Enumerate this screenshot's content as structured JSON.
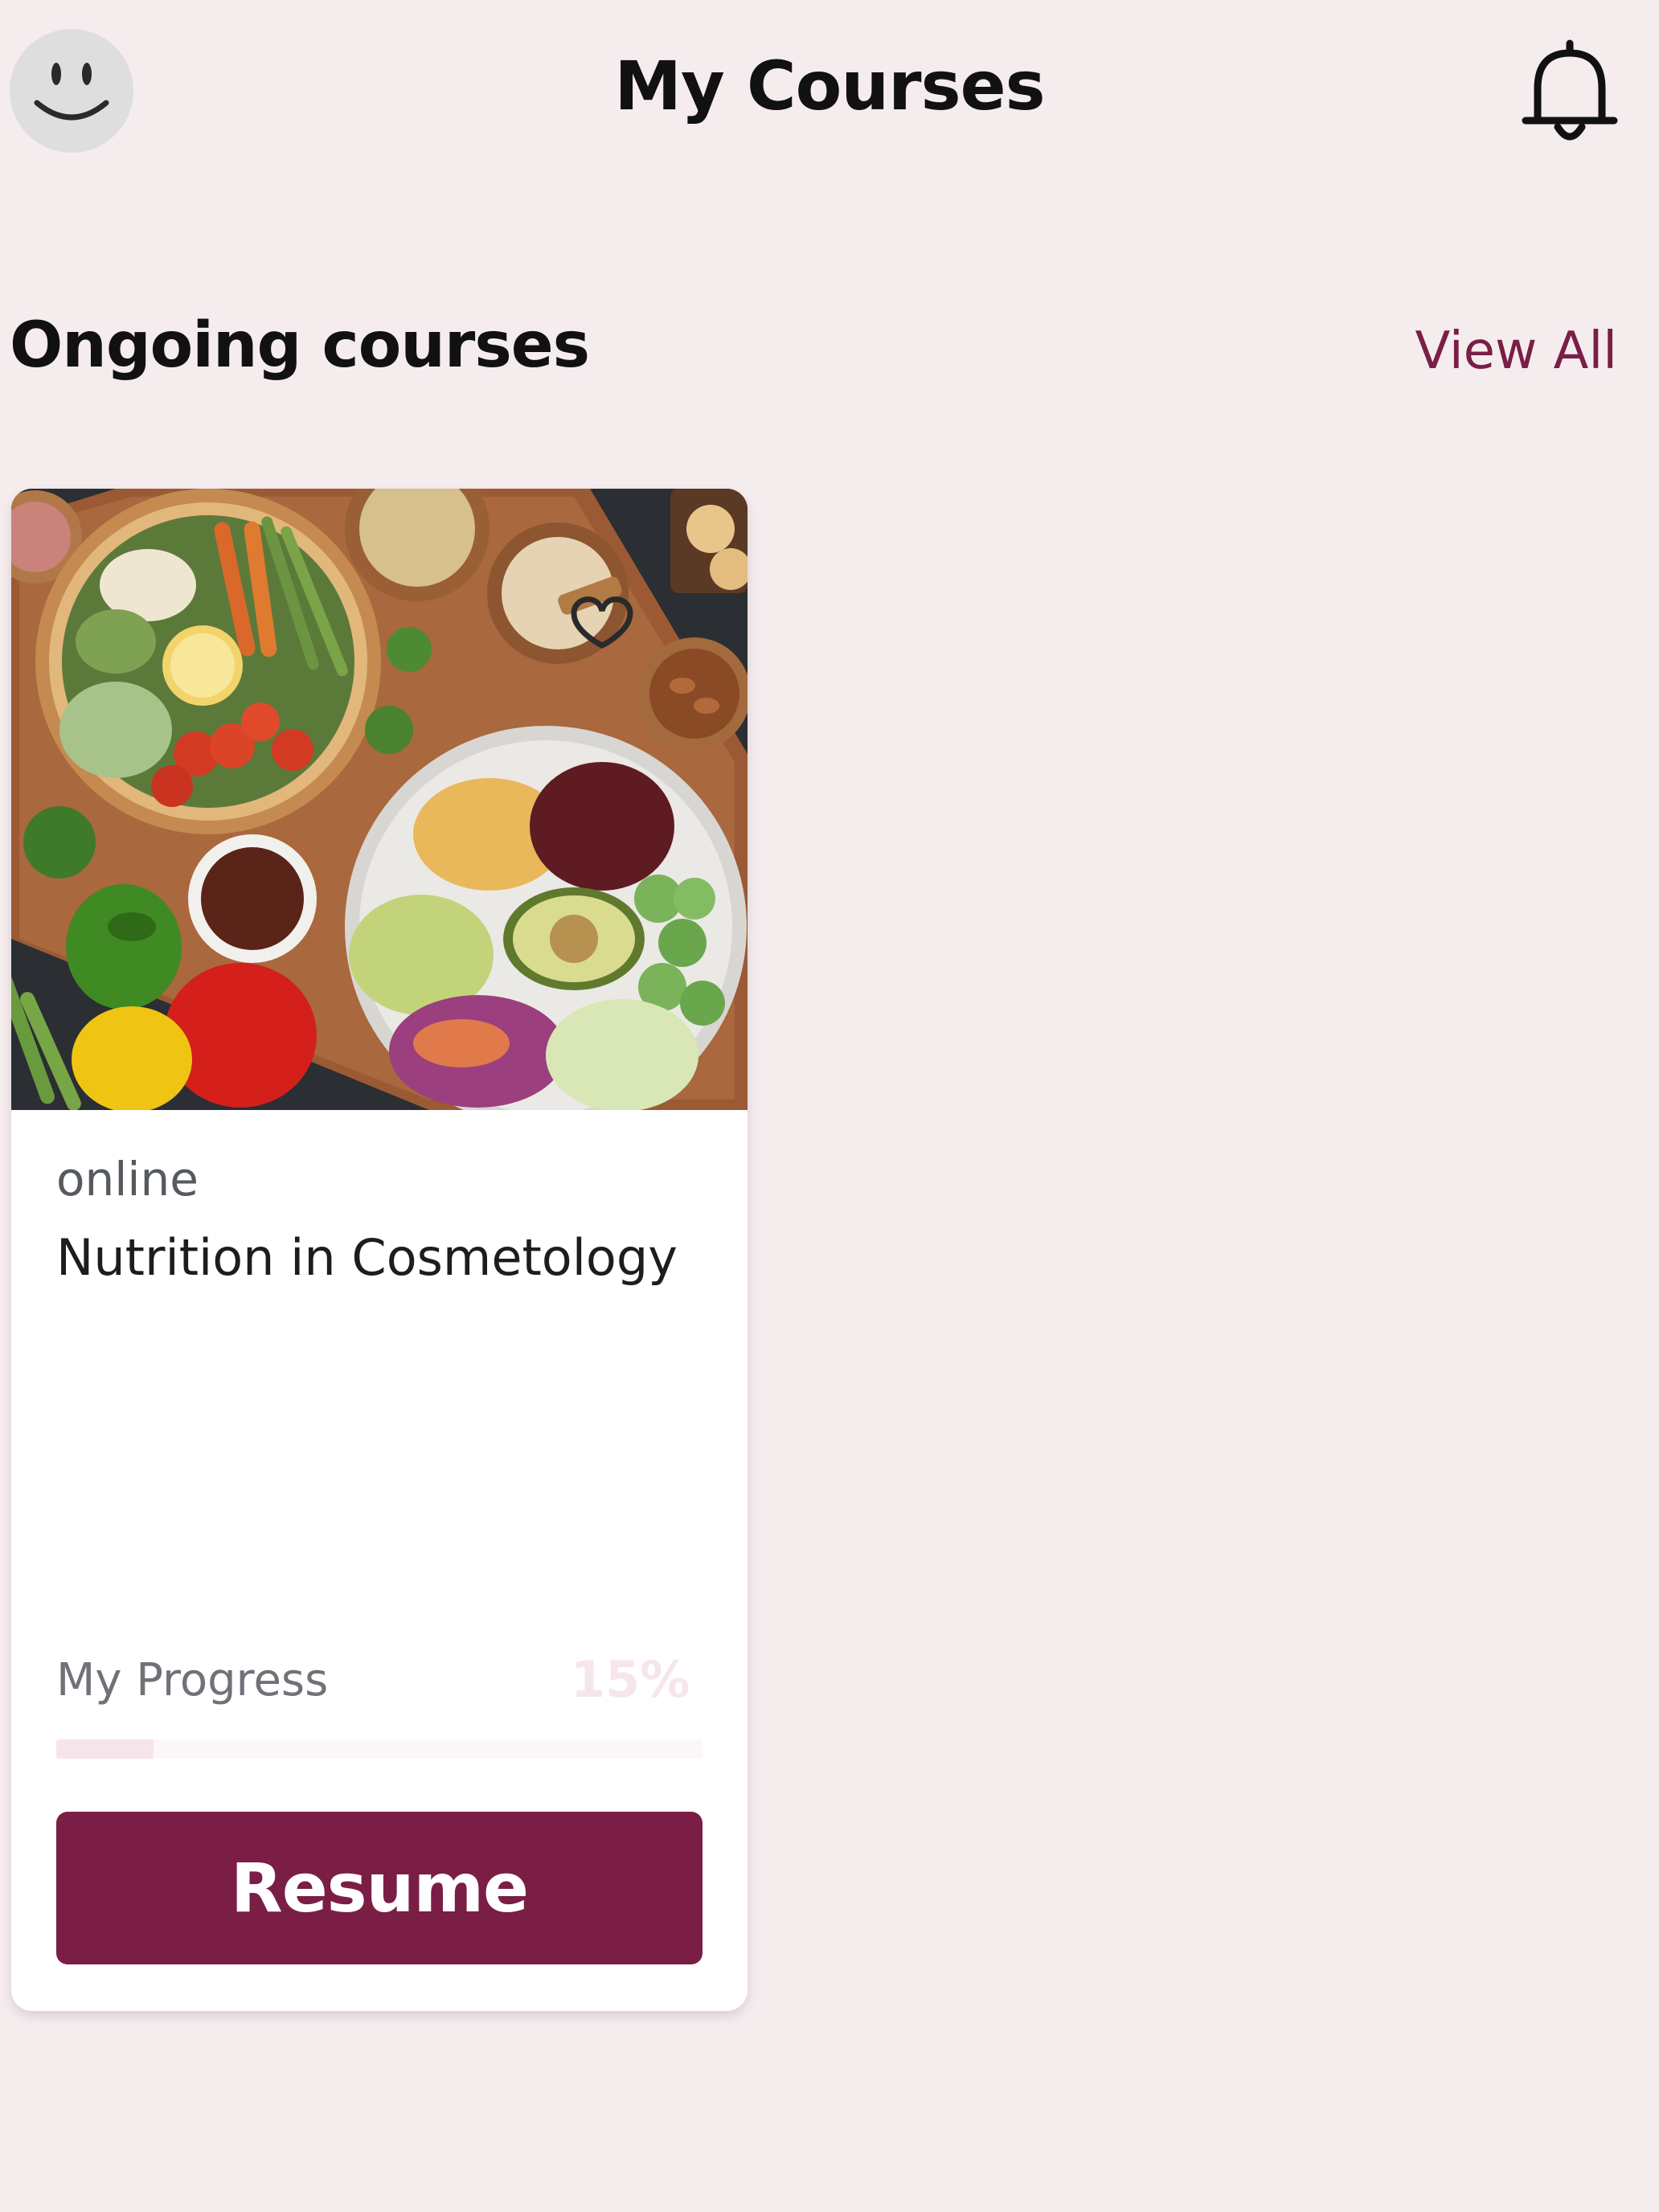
{
  "header": {
    "title": "My Courses",
    "avatar_icon": "smiley-avatar-icon",
    "notification_icon": "bell-icon"
  },
  "section": {
    "title": "Ongoing courses",
    "view_all_label": "View All"
  },
  "course_card": {
    "image_description_icon": "food-bowls-image",
    "favorite_icon": "heart-icon",
    "mode": "online",
    "title": "Nutrition in Cosmetology",
    "progress_label": "My Progress",
    "progress_text": "15%",
    "progress_fraction": 0.15,
    "resume_label": "Resume"
  },
  "colors": {
    "background": "#f5ecee",
    "accent": "#7a1e46",
    "card": "#ffffff"
  }
}
